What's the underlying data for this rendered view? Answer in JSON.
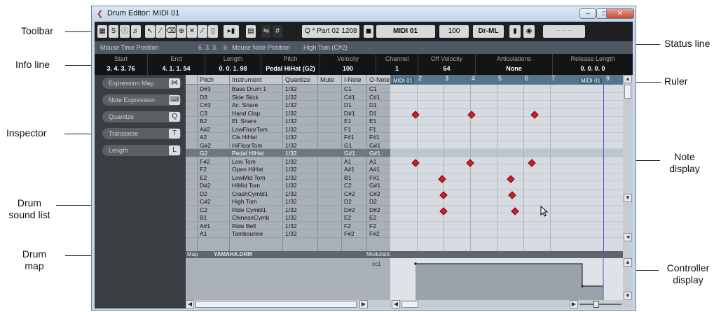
{
  "window": {
    "title": "Drum Editor: MIDI 01"
  },
  "annotations": {
    "toolbar": "Toolbar",
    "info_line": "Info line",
    "inspector": "Inspector",
    "drum_sound_list_1": "Drum",
    "drum_sound_list_2": "sound list",
    "drum_map_1": "Drum",
    "drum_map_2": "map",
    "status_line": "Status line",
    "ruler": "Ruler",
    "note_display_1": "Note",
    "note_display_2": "display",
    "controller_display_1": "Controller",
    "controller_display_2": "display"
  },
  "toolbar": {
    "part_label": "* Part 02",
    "quantize_value": "1208",
    "track_name": "MIDI 01",
    "velocity": "100",
    "dr_label": "Dr-ML"
  },
  "status_line": {
    "mouse_time_label": "Mouse Time Position",
    "mouse_time_value": "6. 3. 3.",
    "mouse_time_suffix": "9",
    "mouse_note_label": "Mouse Note Position",
    "mouse_note_value": "High Tom (C#2)"
  },
  "info_line": [
    {
      "label": "Start",
      "value": "3. 4. 3. 76"
    },
    {
      "label": "End",
      "value": "4. 1. 1. 54"
    },
    {
      "label": "Length",
      "value": "0. 0. 1. 98"
    },
    {
      "label": "Pitch",
      "value": "Pedal HiHat (G2)"
    },
    {
      "label": "Velocity",
      "value": "100"
    },
    {
      "label": "Channel",
      "value": "1"
    },
    {
      "label": "Off Velocity",
      "value": "64"
    },
    {
      "label": "Articulations",
      "value": "None"
    },
    {
      "label": "Release Length",
      "value": "0. 0. 0. 0"
    }
  ],
  "inspector": [
    {
      "label": "Expression Map",
      "icon": "bow-icon"
    },
    {
      "label": "Note Expression",
      "icon": "note-expression-icon"
    },
    {
      "label": "Quantize",
      "icon": "Q"
    },
    {
      "label": "Transpose",
      "icon": "T"
    },
    {
      "label": "Length",
      "icon": "L"
    }
  ],
  "drum_list": {
    "headers": {
      "pitch": "Pitch",
      "instrument": "Instrument",
      "quantize": "Quantize",
      "mute": "Mute",
      "inote": "I-Note",
      "onote": "O-Note"
    },
    "rows": [
      {
        "pitch": "D#3",
        "instrument": "Bass Drum 1",
        "quantize": "1/32",
        "inote": "C1",
        "onote": "C1"
      },
      {
        "pitch": "D3",
        "instrument": "Side Stick",
        "quantize": "1/32",
        "inote": "C#1",
        "onote": "C#1"
      },
      {
        "pitch": "C#3",
        "instrument": "Ac. Snare",
        "quantize": "1/32",
        "inote": "D1",
        "onote": "D1"
      },
      {
        "pitch": "C3",
        "instrument": "Hand Clap",
        "quantize": "1/32",
        "inote": "D#1",
        "onote": "D1"
      },
      {
        "pitch": "B2",
        "instrument": "El. Snare",
        "quantize": "1/32",
        "inote": "E1",
        "onote": "E1"
      },
      {
        "pitch": "A#2",
        "instrument": "LowFloorTom",
        "quantize": "1/32",
        "inote": "F1",
        "onote": "F1"
      },
      {
        "pitch": "A2",
        "instrument": "Cls HiHat",
        "quantize": "1/32",
        "inote": "F#1",
        "onote": "F#1"
      },
      {
        "pitch": "G#2",
        "instrument": "HiFloorTom",
        "quantize": "1/32",
        "inote": "G1",
        "onote": "G#1"
      },
      {
        "pitch": "G2",
        "instrument": "Pedal HiHat",
        "quantize": "1/32",
        "inote": "G#1",
        "onote": "G#1"
      },
      {
        "pitch": "F#2",
        "instrument": "Low Tom",
        "quantize": "1/32",
        "inote": "A1",
        "onote": "A1"
      },
      {
        "pitch": "F2",
        "instrument": "Open HiHat",
        "quantize": "1/32",
        "inote": "A#1",
        "onote": "A#1"
      },
      {
        "pitch": "E2",
        "instrument": "LowMid Tom",
        "quantize": "1/32",
        "inote": "B1",
        "onote": "F#1"
      },
      {
        "pitch": "D#2",
        "instrument": "HiMid Tom",
        "quantize": "1/32",
        "inote": "C2",
        "onote": "G#1"
      },
      {
        "pitch": "D2",
        "instrument": "CrashCymbl1",
        "quantize": "1/32",
        "inote": "C#2",
        "onote": "C#2"
      },
      {
        "pitch": "C#2",
        "instrument": "High Tom",
        "quantize": "1/32",
        "inote": "D2",
        "onote": "D2"
      },
      {
        "pitch": "C2",
        "instrument": "Ride Cymbl1",
        "quantize": "1/32",
        "inote": "D#2",
        "onote": "D#2"
      },
      {
        "pitch": "B1",
        "instrument": "ChineseCymb",
        "quantize": "1/32",
        "inote": "E2",
        "onote": "E2"
      },
      {
        "pitch": "A#1",
        "instrument": "Ride Bell",
        "quantize": "1/32",
        "inote": "F2",
        "onote": "F2"
      },
      {
        "pitch": "A1",
        "instrument": "Tambourine",
        "quantize": "1/32",
        "inote": "F#2",
        "onote": "F#2"
      }
    ]
  },
  "drum_map": {
    "label": "Map",
    "name": "YAMAHA.DRM"
  },
  "controller": {
    "lane_label": "Modulatic",
    "cc": "cc1"
  },
  "ruler": {
    "marker_left": "MIDI 01",
    "marker_right": "MIDI 01",
    "ticks": [
      "2",
      "3",
      "4",
      "5",
      "6",
      "7",
      "9"
    ]
  }
}
